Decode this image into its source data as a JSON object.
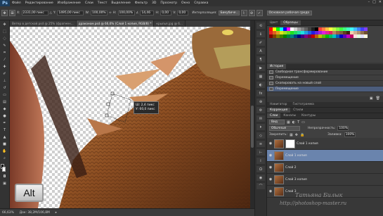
{
  "menubar": {
    "logo": "Ps",
    "items": [
      "Файл",
      "Редактирование",
      "Изображение",
      "Слои",
      "Текст",
      "Выделение",
      "Фильтр",
      "3D",
      "Просмотр",
      "Окно",
      "Справка"
    ],
    "window_controls": [
      "–",
      "□",
      "✕"
    ]
  },
  "options": {
    "x_label": "X:",
    "x_value": "2331,00 пикс",
    "y_label": "Y:",
    "y_value": "1495,00 пикс",
    "w_label": "W:",
    "w_value": "100,00%",
    "h_label": "H:",
    "h_value": "100,00%",
    "angle_value": "14,46",
    "h_skew_label": "H:",
    "h_skew_value": "0,00",
    "v_skew_label": "V:",
    "v_skew_value": "0,00",
    "interpolation_label": "Интерполяция:",
    "interpolation_value": "Бикубиче...",
    "workspace_value": "Основная рабочая среда"
  },
  "tabs": [
    {
      "label": "Ветер в детской.psd @ 25% (фрагмен...",
      "active": false
    },
    {
      "label": "драконом.psd @ 66,6% (Слой 1 копия, RGB/8) *",
      "active": true
    },
    {
      "label": "крылья.jpg @ 6...",
      "active": false
    }
  ],
  "canvas": {
    "tooltip_line1": "Ш: 2,4 пикс",
    "tooltip_line2": "У: 60,0 пикс",
    "alt_key": "Alt"
  },
  "status": {
    "zoom": "66,63%",
    "doc_size": "Док: 38,2M/106,8M"
  },
  "color_panel": {
    "tabs": [
      {
        "label": "Цвет",
        "active": false
      },
      {
        "label": "Образцы",
        "active": true
      }
    ],
    "swatch_rows": [
      [
        "#ff0000",
        "#ffff00",
        "#00ff00",
        "#00ffff",
        "#0000ff",
        "#ff00ff",
        "#ffffff",
        "#d0d0d0",
        "#a0a0a0",
        "#808080",
        "#606060",
        "#404040",
        "#202020",
        "#000000",
        "#ff4040",
        "#ff8040",
        "#ffc040",
        "#ffff40",
        "#c0ff40",
        "#80ff40",
        "#40ff40",
        "#40ff80",
        "#40ffc0",
        "#40ffff",
        "#40c0ff",
        "#4080ff",
        "#4040ff",
        "#8040ff"
      ],
      [
        "#e02020",
        "#e06020",
        "#e0a020",
        "#e0e020",
        "#a0e020",
        "#60e020",
        "#20e020",
        "#20e060",
        "#20e0a0",
        "#20e0e0",
        "#20a0e0",
        "#2060e0",
        "#2020e0",
        "#6020e0",
        "#a020e0",
        "#e020e0",
        "#e020a0",
        "#e02060",
        "#c08060",
        "#a06040",
        "#806040",
        "#604020",
        "#402010",
        "#f0d0b0",
        "#d0b090",
        "#b09070",
        "#907050",
        "#705030"
      ],
      [
        "#800000",
        "#804000",
        "#808000",
        "#408000",
        "#008000",
        "#008040",
        "#008080",
        "#004080",
        "#000080",
        "#400080",
        "#800080",
        "#800040",
        "#c00000",
        "#c06000",
        "#c0c000",
        "#60c000",
        "#00c000",
        "#00c060",
        "#00c0c0",
        "#0060c0",
        "#0000c0",
        "#6000c0",
        "#c000c0",
        "#c00060",
        "#ffe0e0",
        "#e0ffe0",
        "#e0e0ff",
        "#ffffe0"
      ]
    ]
  },
  "history": {
    "title": "История",
    "items": [
      {
        "label": "Свободное трансформирование",
        "selected": false
      },
      {
        "label": "Перемещение",
        "selected": false
      },
      {
        "label": "Скопировать на новый слой",
        "selected": false
      },
      {
        "label": "Перемещение",
        "selected": true
      }
    ]
  },
  "navigator": {
    "tabs": [
      {
        "label": "Навигатор",
        "active": false
      },
      {
        "label": "Гистограмма",
        "active": false
      }
    ]
  },
  "adjust": {
    "tabs": [
      {
        "label": "Коррекция",
        "active": true
      },
      {
        "label": "Стили",
        "active": false
      }
    ]
  },
  "layers": {
    "tabs": [
      {
        "label": "Слои",
        "active": true
      },
      {
        "label": "Каналы",
        "active": false
      },
      {
        "label": "Контуры",
        "active": false
      }
    ],
    "filter_label": "Вид",
    "blend_mode": "Обычные",
    "opacity_label": "Непрозрачность:",
    "opacity_value": "100%",
    "fill_label": "Заливка:",
    "fill_value": "100%",
    "lock_label": "Закрепить:",
    "items": [
      {
        "name": "Слой 1 копия",
        "selected": false,
        "mask": true
      },
      {
        "name": "Слой 1 копия",
        "selected": true,
        "mask": false
      },
      {
        "name": "Слой 2",
        "selected": false,
        "mask": false
      },
      {
        "name": "Слой 3 копия",
        "selected": false,
        "mask": false
      },
      {
        "name": "Слой 3",
        "selected": false,
        "mask": false
      }
    ]
  },
  "watermark": {
    "line1": "Татьяна Билык",
    "line2": "http://photoshop-master.ru"
  }
}
